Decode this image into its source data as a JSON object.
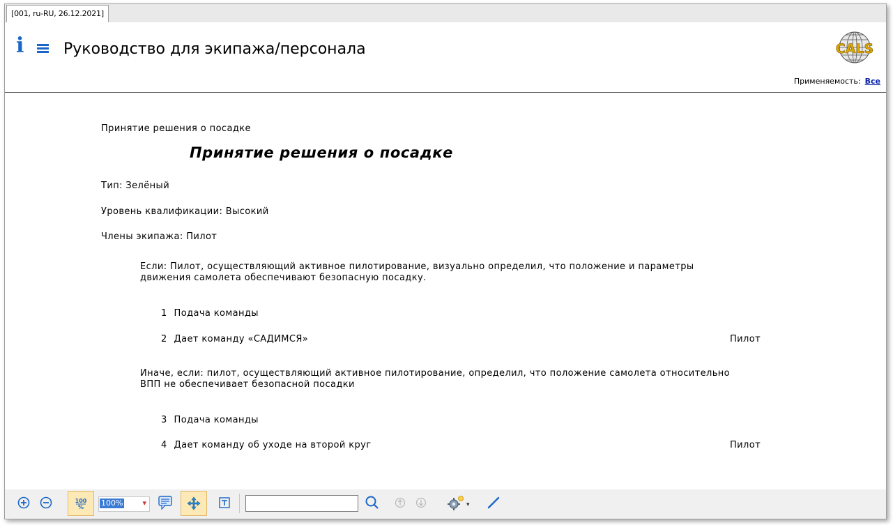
{
  "tab": {
    "label": "[001, ru-RU, 26.12.2021]"
  },
  "header": {
    "title": "Руководство для экипажа/персонала",
    "logo_text": "CALS",
    "applicability_label": "Применяемость:",
    "applicability_value": "Все"
  },
  "doc": {
    "breadcrumb": "Принятие решения о посадке",
    "heading": "Принятие решения о посадке",
    "type_line": "Тип: Зелёный",
    "qualification_line": "Уровень квалификации: Высокий",
    "crew_line": "Члены экипажа: Пилот",
    "condition1": {
      "line1": "Если: Пилот, осуществляющий активное пилотирование, визуально определил, что положение и параметры",
      "line2": "движения самолета обеспечивают безопасную посадку."
    },
    "steps1": [
      {
        "num": "1",
        "text": "Подача команды",
        "actor": ""
      },
      {
        "num": "2",
        "text": "Дает команду «САДИМСЯ»",
        "actor": "Пилот"
      }
    ],
    "condition2": {
      "line1": "Иначе, если: пилот, осуществляющий активное пилотирование, определил, что положение самолета относительно",
      "line2": "ВПП не обеспечивает безопасной посадки"
    },
    "steps2": [
      {
        "num": "3",
        "text": "Подача команды",
        "actor": ""
      },
      {
        "num": "4",
        "text": "Дает команду об уходе на второй круг",
        "actor": "Пилот"
      }
    ]
  },
  "toolbar": {
    "zoom_value": "100%",
    "search_value": "",
    "icons": [
      "zoom-in-icon",
      "zoom-out-icon",
      "actual-size-icon",
      "comment-icon",
      "pan-icon",
      "text-select-icon",
      "search-icon",
      "arrow-up-icon",
      "arrow-down-icon",
      "settings-icon",
      "pen-icon"
    ]
  },
  "colors": {
    "accent": "#1a66c8",
    "link": "#0a24a8",
    "active_button": "#fde9b6"
  }
}
